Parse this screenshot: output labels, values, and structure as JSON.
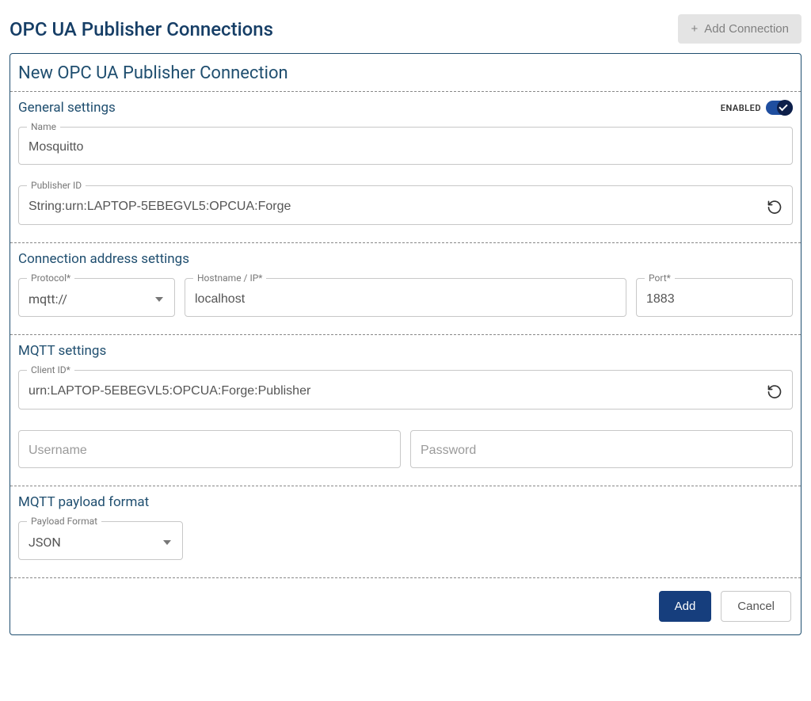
{
  "header": {
    "title": "OPC UA Publisher Connections",
    "addBtn": "Add Connection"
  },
  "panel": {
    "title": "New OPC UA Publisher Connection"
  },
  "general": {
    "title": "General settings",
    "enabledLabel": "ENABLED",
    "name": {
      "label": "Name",
      "value": "Mosquitto"
    },
    "publisherId": {
      "label": "Publisher ID",
      "value": "String:urn:LAPTOP-5EBEGVL5:OPCUA:Forge"
    }
  },
  "conn": {
    "title": "Connection address settings",
    "protocol": {
      "label": "Protocol*",
      "value": "mqtt://"
    },
    "hostname": {
      "label": "Hostname / IP*",
      "value": "localhost"
    },
    "port": {
      "label": "Port*",
      "value": "1883"
    }
  },
  "mqtt": {
    "title": "MQTT settings",
    "clientId": {
      "label": "Client ID*",
      "value": "urn:LAPTOP-5EBEGVL5:OPCUA:Forge:Publisher"
    },
    "username": {
      "placeholder": "Username",
      "value": ""
    },
    "password": {
      "placeholder": "Password",
      "value": ""
    }
  },
  "payload": {
    "title": "MQTT payload format",
    "format": {
      "label": "Payload Format",
      "value": "JSON"
    }
  },
  "footer": {
    "add": "Add",
    "cancel": "Cancel"
  }
}
